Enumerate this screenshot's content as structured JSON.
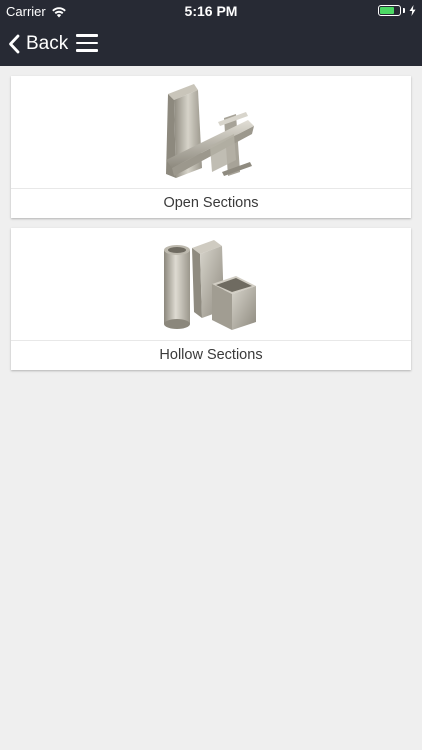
{
  "status_bar": {
    "carrier": "Carrier",
    "time": "5:16 PM",
    "battery_level": 0.75,
    "battery_color": "#4cd964"
  },
  "nav": {
    "back_label": "Back",
    "back_icon": "chevron-left-icon",
    "menu_icon": "hamburger-menu-icon",
    "bar_color": "#272a34"
  },
  "sections": [
    {
      "label": "Open Sections",
      "image": "open-sections-image"
    },
    {
      "label": "Hollow Sections",
      "image": "hollow-sections-image"
    }
  ]
}
